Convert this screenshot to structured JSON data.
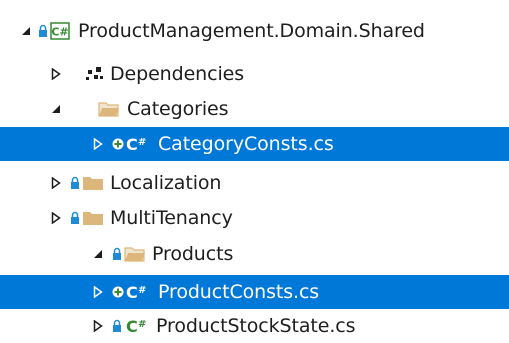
{
  "solution_tree": {
    "project": {
      "label": "ProductManagement.Domain.Shared",
      "icon": "csharp-project-icon",
      "expanded": true
    },
    "items": [
      {
        "label": "Dependencies",
        "icon": "dependencies-icon",
        "expanded": false,
        "selected": false
      },
      {
        "label": "Categories",
        "icon": "folder-open-icon",
        "expanded": true,
        "selected": false
      },
      {
        "label": "CategoryConsts.cs",
        "icon": "csharp-file-added-icon",
        "expanded": false,
        "selected": true
      },
      {
        "label": "Localization",
        "icon": "folder-locked-icon",
        "expanded": false,
        "selected": false
      },
      {
        "label": "MultiTenancy",
        "icon": "folder-locked-icon",
        "expanded": false,
        "selected": false
      },
      {
        "label": "Products",
        "icon": "folder-open-locked-icon",
        "expanded": true,
        "selected": false
      },
      {
        "label": "ProductConsts.cs",
        "icon": "csharp-file-added-icon",
        "expanded": false,
        "selected": true
      },
      {
        "label": "ProductStockState.cs",
        "icon": "csharp-file-locked-icon",
        "expanded": false,
        "selected": false
      }
    ]
  },
  "colors": {
    "selection": "#0078d7",
    "text": "#1e1e1e",
    "lock": "#1f8ad6",
    "folder": "#dcb67a",
    "csharp": "#368832",
    "add": "#388a34"
  }
}
